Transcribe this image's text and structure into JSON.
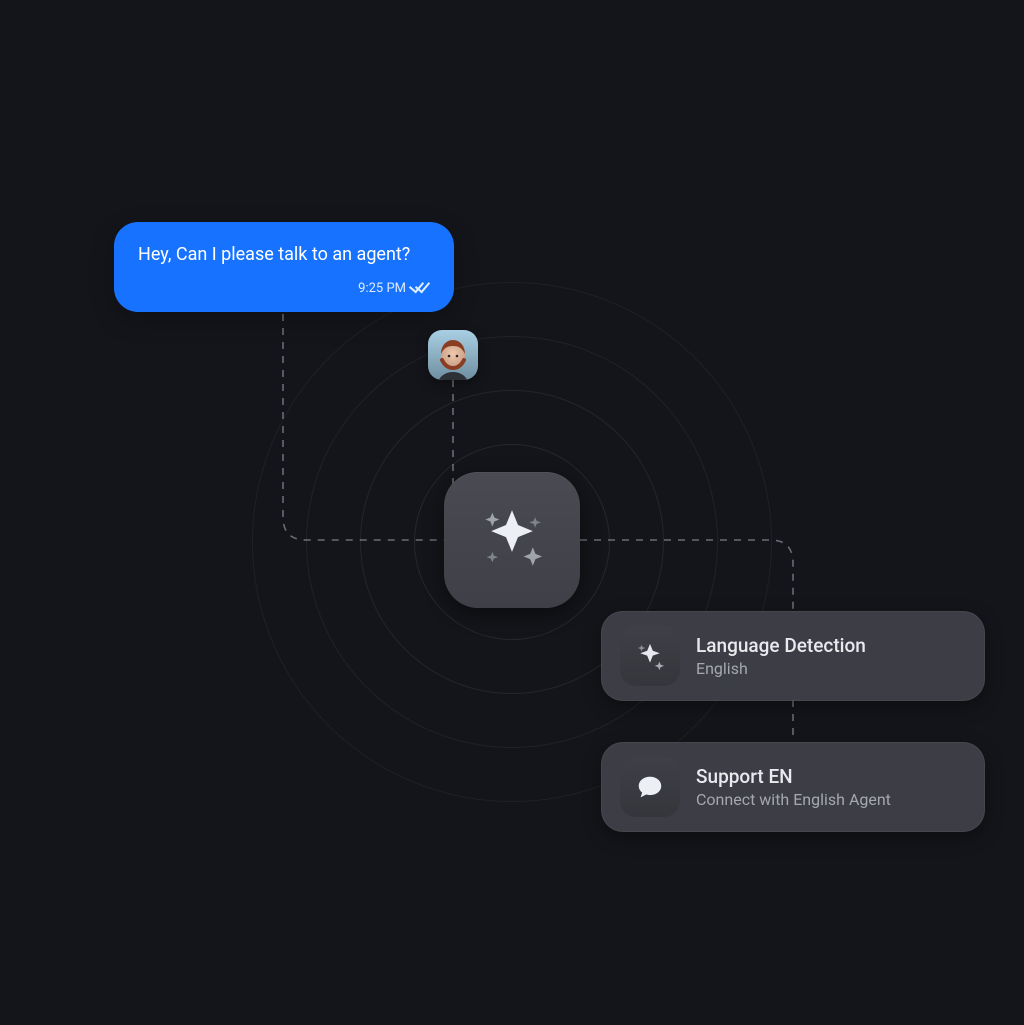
{
  "chat": {
    "message": "Hey, Can I please talk to an agent?",
    "timestamp": "9:25 PM"
  },
  "participant": {
    "avatar_desc": "user-photo"
  },
  "ai_core": {
    "icon": "sparkles-icon"
  },
  "steps": [
    {
      "icon": "sparkles-icon",
      "title": "Language Detection",
      "subtitle": "English"
    },
    {
      "icon": "chat-bubble-icon",
      "title": "Support EN",
      "subtitle": "Connect with English Agent"
    }
  ],
  "colors": {
    "background": "#14151a",
    "accent": "#1773ff",
    "text_primary": "#e9eaee",
    "text_secondary": "#a5a8b0"
  }
}
